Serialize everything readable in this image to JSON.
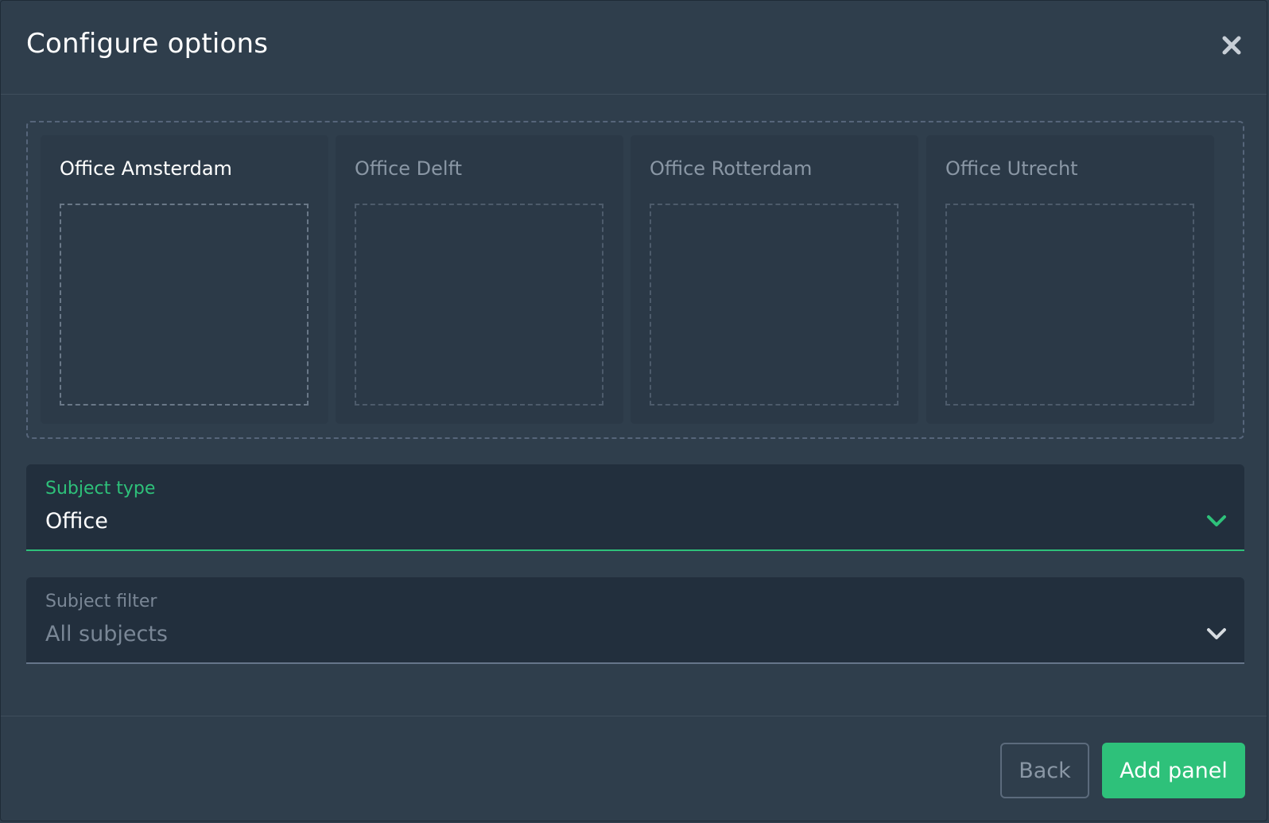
{
  "dialog": {
    "title": "Configure options",
    "close_icon": "close-icon"
  },
  "cards": [
    {
      "label": "Office Amsterdam",
      "active": true
    },
    {
      "label": "Office Delft",
      "active": false
    },
    {
      "label": "Office Rotterdam",
      "active": false
    },
    {
      "label": "Office Utrecht",
      "active": false
    }
  ],
  "subject_type": {
    "label": "Subject type",
    "value": "Office",
    "icon": "chevron-down-icon"
  },
  "subject_filter": {
    "label": "Subject filter",
    "value": "All subjects",
    "icon": "chevron-down-icon"
  },
  "footer": {
    "back_label": "Back",
    "add_label": "Add panel"
  },
  "colors": {
    "background": "#2f3e4c",
    "accent": "#2ec17a",
    "field_bg": "#222f3d",
    "card_bg": "#2b3947"
  }
}
